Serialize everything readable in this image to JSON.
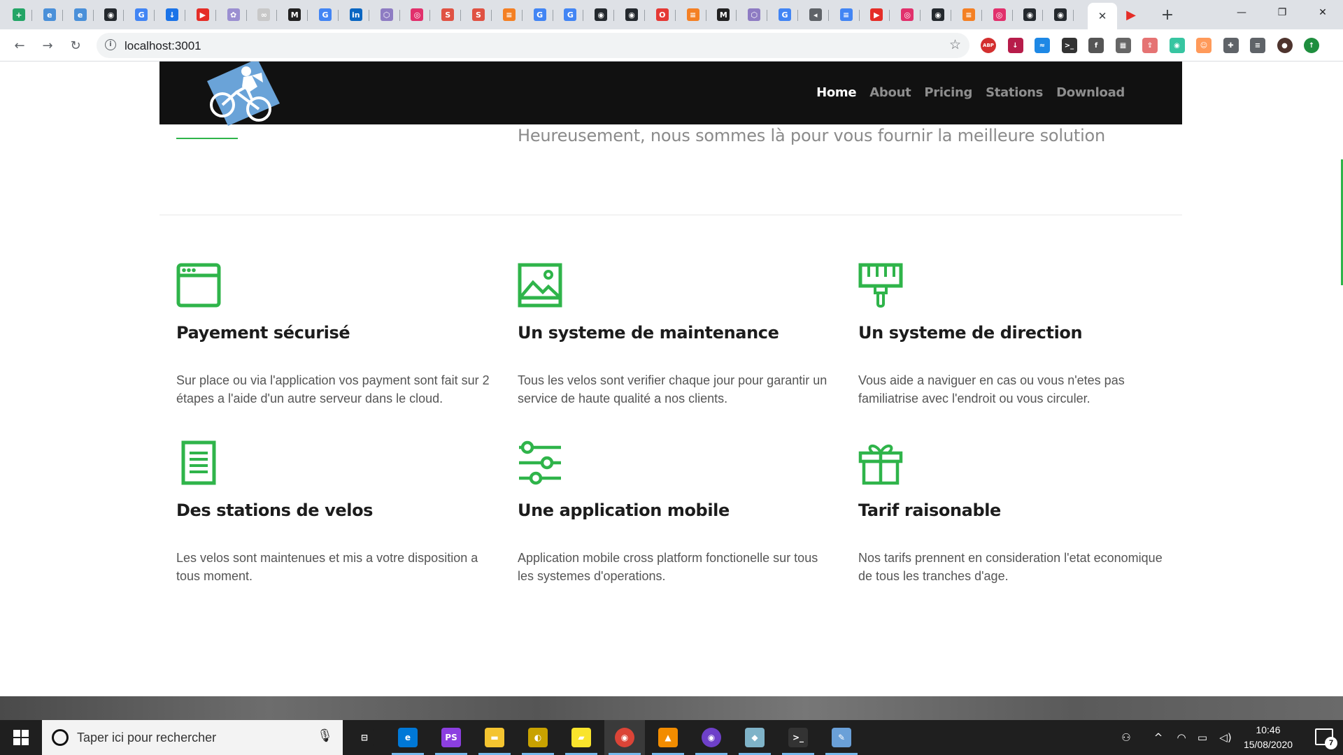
{
  "browser": {
    "tabs": [
      {
        "icon": "sheets-icon",
        "color": "#23a566",
        "glyph": "+"
      },
      {
        "icon": "edge-icon",
        "color": "#4a90d9",
        "glyph": "e"
      },
      {
        "icon": "edge-icon",
        "color": "#4a90d9",
        "glyph": "e"
      },
      {
        "icon": "github-icon",
        "color": "#24292e",
        "glyph": "◉"
      },
      {
        "icon": "google-icon",
        "color": "#4285f4",
        "glyph": "G"
      },
      {
        "icon": "download-icon",
        "color": "#1a73e8",
        "glyph": "↓"
      },
      {
        "icon": "youtube-icon",
        "color": "#e52d27",
        "glyph": "▶"
      },
      {
        "icon": "nodes-icon",
        "color": "#9b8fd1",
        "glyph": "✿"
      },
      {
        "icon": "nodes-icon",
        "color": "#c8c8c8",
        "glyph": "∞"
      },
      {
        "icon": "medium-icon",
        "color": "#222222",
        "glyph": "M"
      },
      {
        "icon": "google-icon",
        "color": "#4285f4",
        "glyph": "G"
      },
      {
        "icon": "linkedin-icon",
        "color": "#0a66c2",
        "glyph": "in"
      },
      {
        "icon": "graphql-icon",
        "color": "#8e7cc3",
        "glyph": "⬡"
      },
      {
        "icon": "instagram-icon",
        "color": "#e1306c",
        "glyph": "◎"
      },
      {
        "icon": "swift-icon",
        "color": "#e05243",
        "glyph": "S"
      },
      {
        "icon": "swift-icon",
        "color": "#e05243",
        "glyph": "S"
      },
      {
        "icon": "stackoverflow-icon",
        "color": "#f48024",
        "glyph": "≡"
      },
      {
        "icon": "google-icon",
        "color": "#4285f4",
        "glyph": "G"
      },
      {
        "icon": "google-icon",
        "color": "#4285f4",
        "glyph": "G"
      },
      {
        "icon": "github-icon",
        "color": "#24292e",
        "glyph": "◉"
      },
      {
        "icon": "github-icon",
        "color": "#24292e",
        "glyph": "◉"
      },
      {
        "icon": "opera-icon",
        "color": "#e53935",
        "glyph": "O"
      },
      {
        "icon": "stackoverflow-icon",
        "color": "#f48024",
        "glyph": "≡"
      },
      {
        "icon": "medium-icon",
        "color": "#222222",
        "glyph": "M"
      },
      {
        "icon": "graphql-icon",
        "color": "#8e7cc3",
        "glyph": "⬡"
      },
      {
        "icon": "google-icon",
        "color": "#4285f4",
        "glyph": "G"
      },
      {
        "icon": "audio-icon",
        "color": "#5f6368",
        "glyph": "◂"
      },
      {
        "icon": "docs-icon",
        "color": "#4285f4",
        "glyph": "≡"
      },
      {
        "icon": "youtube-icon",
        "color": "#e52d27",
        "glyph": "▶"
      },
      {
        "icon": "instagram-icon",
        "color": "#e1306c",
        "glyph": "◎"
      },
      {
        "icon": "github-icon",
        "color": "#24292e",
        "glyph": "◉"
      },
      {
        "icon": "stackoverflow-icon",
        "color": "#f48024",
        "glyph": "≡"
      },
      {
        "icon": "instagram-icon",
        "color": "#e1306c",
        "glyph": "◎"
      },
      {
        "icon": "github-icon",
        "color": "#24292e",
        "glyph": "◉"
      },
      {
        "icon": "github-icon",
        "color": "#24292e",
        "glyph": "◉"
      }
    ],
    "active_tab_close": "✕",
    "extra_tab": {
      "icon": "youtube-play-icon",
      "color": "#e52d27",
      "glyph": "▶"
    },
    "new_tab": "+",
    "window_controls": {
      "minimize": "—",
      "maximize": "❐",
      "close": "✕"
    },
    "back": "←",
    "forward": "→",
    "reload": "↻",
    "info_glyph": "i",
    "url": "localhost:3001",
    "bookmark_star": "☆",
    "extensions": [
      {
        "icon": "adblock-icon",
        "color": "#d32f2f",
        "glyph": "ABP"
      },
      {
        "icon": "download-manager-icon",
        "color": "#b71c4a",
        "glyph": "↓"
      },
      {
        "icon": "messenger-icon",
        "color": "#1e88e5",
        "glyph": "≈"
      },
      {
        "icon": "terminal-icon",
        "color": "#333333",
        "glyph": ">_"
      },
      {
        "icon": "facebook-icon",
        "color": "#555555",
        "glyph": "f"
      },
      {
        "icon": "keyboard-icon",
        "color": "#666666",
        "glyph": "▦"
      },
      {
        "icon": "share-icon",
        "color": "#e57373",
        "glyph": "⇪"
      },
      {
        "icon": "grammarly-icon",
        "color": "#37c5a1",
        "glyph": "◉"
      },
      {
        "icon": "face-icon",
        "color": "#ff9a5a",
        "glyph": "☺"
      },
      {
        "icon": "puzzle-icon",
        "color": "#5f6368",
        "glyph": "✚"
      },
      {
        "icon": "media-queue-icon",
        "color": "#5f6368",
        "glyph": "≡"
      },
      {
        "icon": "profile-avatar-icon",
        "color": "#4e342e",
        "glyph": "●"
      },
      {
        "icon": "update-icon",
        "color": "#1e8e3e",
        "glyph": "↑"
      }
    ]
  },
  "site": {
    "nav": {
      "items": [
        "Home",
        "About",
        "Pricing",
        "Stations",
        "Download"
      ],
      "active": "Home"
    },
    "lead": "Heureusement, nous sommes là pour vous fournir la meilleure solution",
    "accent_color": "#2fb44a",
    "features": [
      {
        "icon": "browser-window-icon",
        "title": "Payement sécurisé",
        "text": "Sur place ou via l'application vos payment sont fait sur 2 étapes a l'aide d'un autre serveur dans le cloud."
      },
      {
        "icon": "image-icon",
        "title": "Un systeme de maintenance",
        "text": "Tous les velos sont verifier chaque jour pour garantir un service de haute qualité a nos clients."
      },
      {
        "icon": "paint-brush-icon",
        "title": "Un systeme de direction",
        "text": "Vous aide a naviguer en cas ou vous n'etes pas familiatrise avec l'endroit ou vous circuler."
      },
      {
        "icon": "document-icon",
        "title": "Des stations de velos",
        "text": "Les velos sont maintenues et mis a votre disposition a tous moment."
      },
      {
        "icon": "sliders-icon",
        "title": "Une application mobile",
        "text": "Application mobile cross platform fonctionelle sur tous les systemes d'operations."
      },
      {
        "icon": "gift-icon",
        "title": "Tarif raisonable",
        "text": "Nos tarifs prennent en consideration l'etat economique de tous les tranches d'age."
      }
    ]
  },
  "taskbar": {
    "search_placeholder": "Taper ici pour rechercher",
    "apps": [
      {
        "icon": "task-view-icon",
        "color": "#1f1f1f",
        "glyph": "⊟"
      },
      {
        "icon": "edge-browser-icon",
        "color": "#0078d7",
        "glyph": "e"
      },
      {
        "icon": "phpstorm-icon",
        "color": "#8c3fe0",
        "glyph": "PS"
      },
      {
        "icon": "file-explorer-icon",
        "color": "#f4c430",
        "glyph": "▬"
      },
      {
        "icon": "app-icon",
        "color": "#c8a200",
        "glyph": "◐"
      },
      {
        "icon": "sticky-notes-icon",
        "color": "#f9e42c",
        "glyph": "▰"
      },
      {
        "icon": "chrome-icon",
        "color": "#db4437",
        "glyph": "◉"
      },
      {
        "icon": "vlc-icon",
        "color": "#f28c00",
        "glyph": "▲"
      },
      {
        "icon": "github-desktop-icon",
        "color": "#6e40c9",
        "glyph": "◉"
      },
      {
        "icon": "app-icon",
        "color": "#7fb3c8",
        "glyph": "◆"
      },
      {
        "icon": "cmd-icon",
        "color": "#333333",
        "glyph": ">_"
      },
      {
        "icon": "paint-icon",
        "color": "#6aa0d8",
        "glyph": "✎"
      }
    ],
    "tray": {
      "people": "⚇",
      "chevron": "^",
      "wifi": "◠",
      "battery": "▭",
      "volume": "◁)"
    },
    "time": "10:46",
    "date": "15/08/2020",
    "notifications": "7"
  }
}
